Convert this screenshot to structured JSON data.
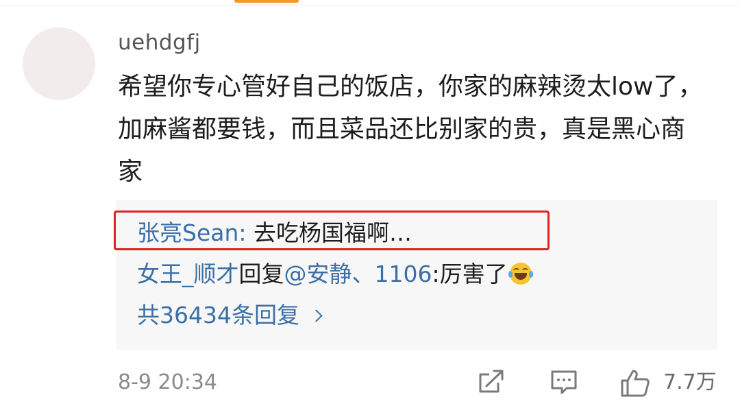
{
  "comment": {
    "username": "uehdgfj",
    "text": "希望你专心管好自己的饭店，你家的麻辣烫太low了，加麻酱都要钱，而且菜品还比别家的贵，真是黑心商家",
    "timestamp": "8-9 20:34",
    "like_count": "7.7万"
  },
  "replies": [
    {
      "author": "张亮Sean",
      "separator": ": ",
      "body": "去吃杨国福啊…"
    },
    {
      "author": "女王_顺才",
      "reply_word": "回复",
      "mention": "@安静、1106",
      "separator": ":",
      "body": "厉害了",
      "emoji": "laughing-tears-emoji"
    }
  ],
  "more_replies_label": "共36434条回复",
  "icons": {
    "share": "share-icon",
    "comment": "comment-icon",
    "like": "like-icon",
    "more": "chevron-right-icon"
  },
  "colors": {
    "link_blue": "#3a6fa6",
    "highlight_red": "#e02020",
    "accent_orange": "#f29a2e"
  }
}
